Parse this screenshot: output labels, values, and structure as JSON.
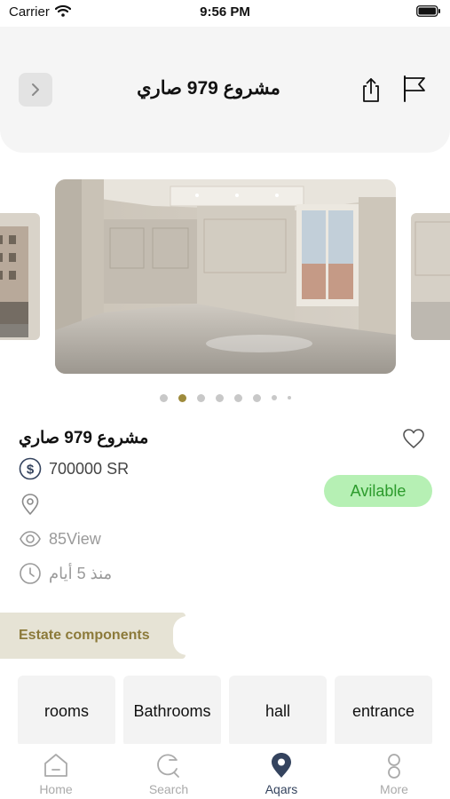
{
  "status_bar": {
    "carrier": "Carrier",
    "time": "9:56 PM"
  },
  "header": {
    "title": "مشروع 979 صاري",
    "back_icon": "chevron-right-icon",
    "share_icon": "share-icon",
    "report_icon": "flag-icon"
  },
  "gallery": {
    "slide_count": 8,
    "active_index": 1
  },
  "property": {
    "title": "مشروع 979 صاري",
    "price": "700000 SR",
    "location": "",
    "views": "85View",
    "posted": "منذ 5 أيام",
    "status": "Avilable"
  },
  "components": {
    "heading": "Estate components",
    "items": [
      "rooms",
      "Bathrooms",
      "hall",
      "entrance"
    ]
  },
  "tab_bar": {
    "items": [
      {
        "label": "Home",
        "icon": "home-icon"
      },
      {
        "label": "Search",
        "icon": "search-icon"
      },
      {
        "label": "Aqars",
        "icon": "location-pin-icon"
      },
      {
        "label": "More",
        "icon": "profile-icon"
      }
    ],
    "active": "Aqars"
  },
  "colors": {
    "accent": "#9e8b3c",
    "available_bg": "#b6f0b4",
    "available_text": "#2c9b2c",
    "tab_active": "#34435e",
    "section_tag_bg": "#e6e3d5"
  }
}
